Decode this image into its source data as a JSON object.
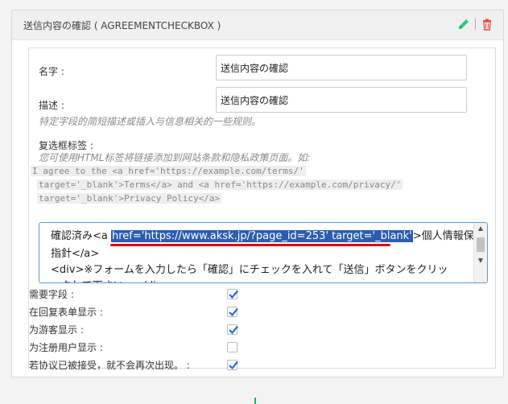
{
  "header": {
    "title": "送信内容の確認 ( AGREEMENTCHECKBOX )",
    "edit_icon": "pencil-icon",
    "delete_icon": "trash-icon",
    "edit_color": "#2ecc71",
    "delete_color": "#e74c3c"
  },
  "fields": {
    "name_label": "名字 :",
    "name_value": "送信内容の確認",
    "desc_label": "描述 :",
    "desc_value": "送信内容の確認",
    "desc_help": "特定字段的简短描述或插入与信息相关的一些规则。",
    "checkbox_label_label": "复选框标签 :",
    "checkbox_label_help": "您可使用HTML标签将链接添加到网站条款和隐私政策页面。如:",
    "code_example": [
      " I agree to the <a href='https://example.com/terms/'",
      "target='_blank'>Terms</a> and <a href='https://example.com/privacy/'",
      "target='_blank'>Privacy Policy</a>"
    ],
    "textarea": {
      "line1_before": "確認済み<a ",
      "line1_selected": "href='https://www.aksk.jp/?page_id=253' target='_blank'",
      "line1_after": ">個人情報保護",
      "line2": "指針</a>",
      "line3": "<div>※フォームを入力したら「確認」にチェックを入れて「送信」ボタンをクリッ",
      "line4": "ックして下さい。</div>"
    }
  },
  "options": [
    {
      "label": "需要字段 :",
      "checked": true
    },
    {
      "label": "在回复表单显示 :",
      "checked": true
    },
    {
      "label": "为游客显示 :",
      "checked": true
    },
    {
      "label": "为注册用户显示 :",
      "checked": false
    },
    {
      "label": "若协议已被接受，就不会再次出现。 :",
      "checked": true
    }
  ],
  "colors": {
    "selection": "#2a5db0",
    "underline": "#e00000",
    "check": "#2c6ed5",
    "focus_border": "#5b9bd5"
  }
}
